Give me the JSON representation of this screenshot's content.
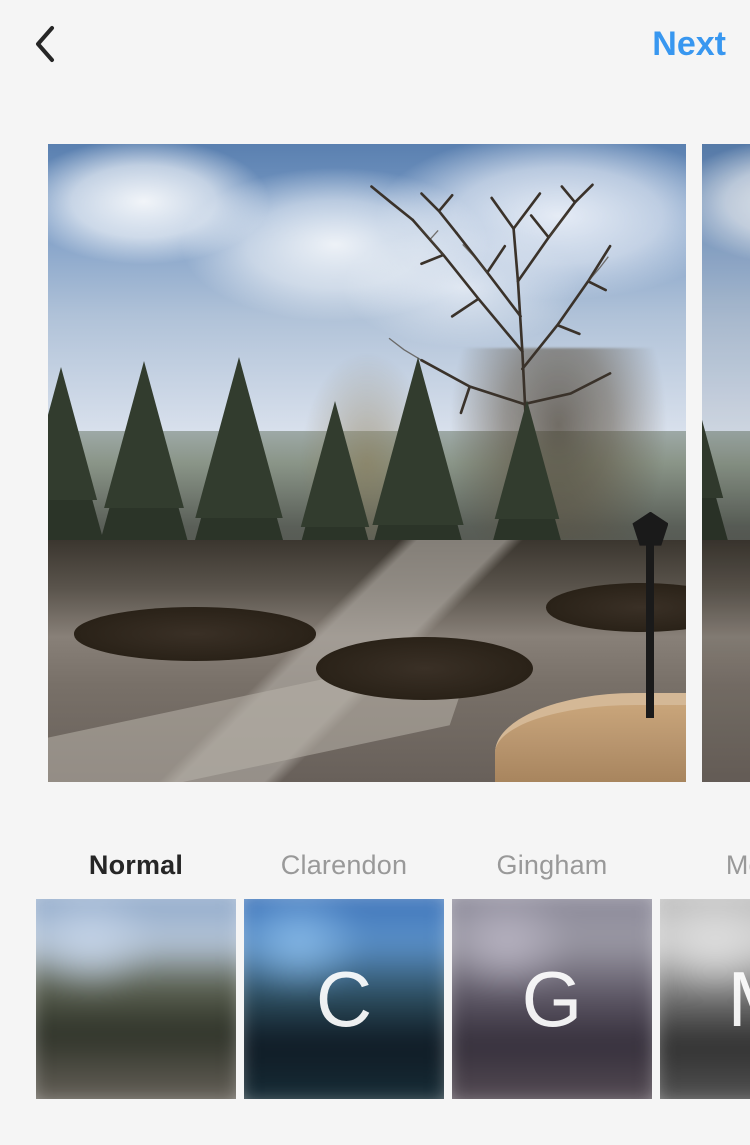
{
  "header": {
    "next_label": "Next"
  },
  "filters": [
    {
      "id": "normal",
      "label": "Normal",
      "letter": "",
      "selected": true
    },
    {
      "id": "clarendon",
      "label": "Clarendon",
      "letter": "C",
      "selected": false
    },
    {
      "id": "gingham",
      "label": "Gingham",
      "letter": "G",
      "selected": false
    },
    {
      "id": "moon",
      "label": "Moon",
      "letter": "M",
      "selected": false
    }
  ],
  "colors": {
    "accent": "#3897f0",
    "text_primary": "#262626",
    "text_secondary": "#999999"
  }
}
